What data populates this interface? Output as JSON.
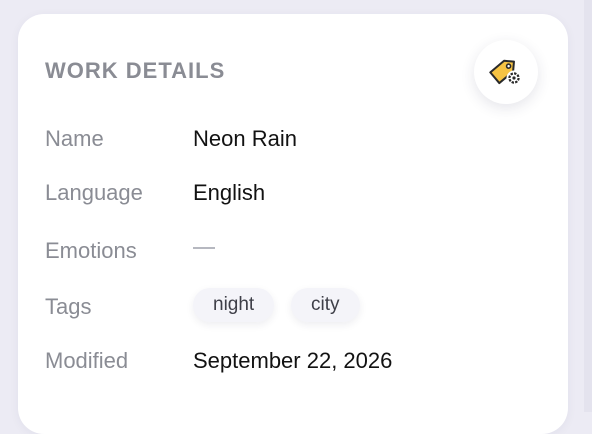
{
  "panel": {
    "title": "WORK DETAILS",
    "edit_button_icon": "tag-gear-icon",
    "rows": {
      "name": {
        "label": "Name",
        "value": "Neon Rain"
      },
      "language": {
        "label": "Language",
        "value": "English"
      },
      "emotions": {
        "label": "Emotions",
        "value": "—"
      },
      "tags": {
        "label": "Tags",
        "items": [
          "night",
          "city"
        ]
      },
      "modified": {
        "label": "Modified",
        "value": "September 22, 2026"
      }
    }
  },
  "colors": {
    "background": "#ecebf4",
    "card": "#ffffff",
    "label": "#8a8c94",
    "value": "#121212",
    "tag_bg": "#f4f4f9",
    "icon_fill": "#f6c343"
  }
}
